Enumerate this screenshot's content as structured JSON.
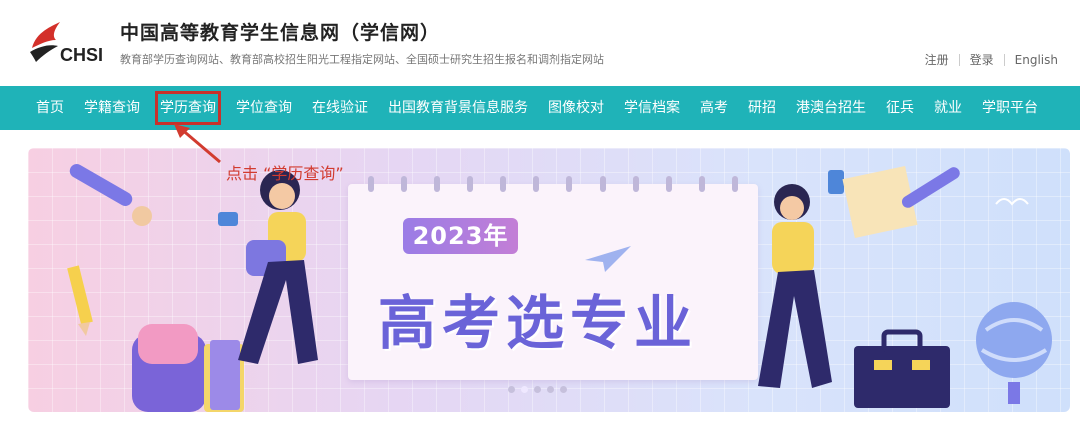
{
  "header": {
    "logo_text": "CHSI",
    "title": "中国高等教育学生信息网（学信网）",
    "subtitle": "教育部学历查询网站、教育部高校招生阳光工程指定网站、全国硕士研究生招生报名和调剂指定网站",
    "links": [
      "注册",
      "登录",
      "English"
    ]
  },
  "nav": {
    "items": [
      "首页",
      "学籍查询",
      "学历查询",
      "学位查询",
      "在线验证",
      "出国教育背景信息服务",
      "图像校对",
      "学信档案",
      "高考",
      "研招",
      "港澳台招生",
      "征兵",
      "就业",
      "学职平台"
    ],
    "highlighted_index": 2
  },
  "annotation": {
    "text": "点击 “学历查询”",
    "color": "#d23b2f"
  },
  "banner": {
    "year_label": "2023年",
    "headline": "高考选专业",
    "slide_count": 5,
    "active_slide": 1
  },
  "colors": {
    "nav_bg": "#1fb3b8",
    "highlight": "#c8312b",
    "headline": "#6a63d8"
  }
}
